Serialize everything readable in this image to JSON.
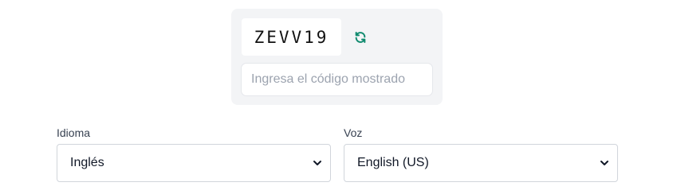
{
  "captcha": {
    "code": "ZEVV19",
    "refresh_icon": "refresh-icon",
    "input_placeholder": "Ingresa el código mostrado",
    "input_value": "",
    "accent_color": "#0f8a6e"
  },
  "language": {
    "label": "Idioma",
    "selected": "Inglés",
    "icon": "chevron-down-icon"
  },
  "voice": {
    "label": "Voz",
    "selected": "English (US)",
    "icon": "chevron-down-icon"
  }
}
